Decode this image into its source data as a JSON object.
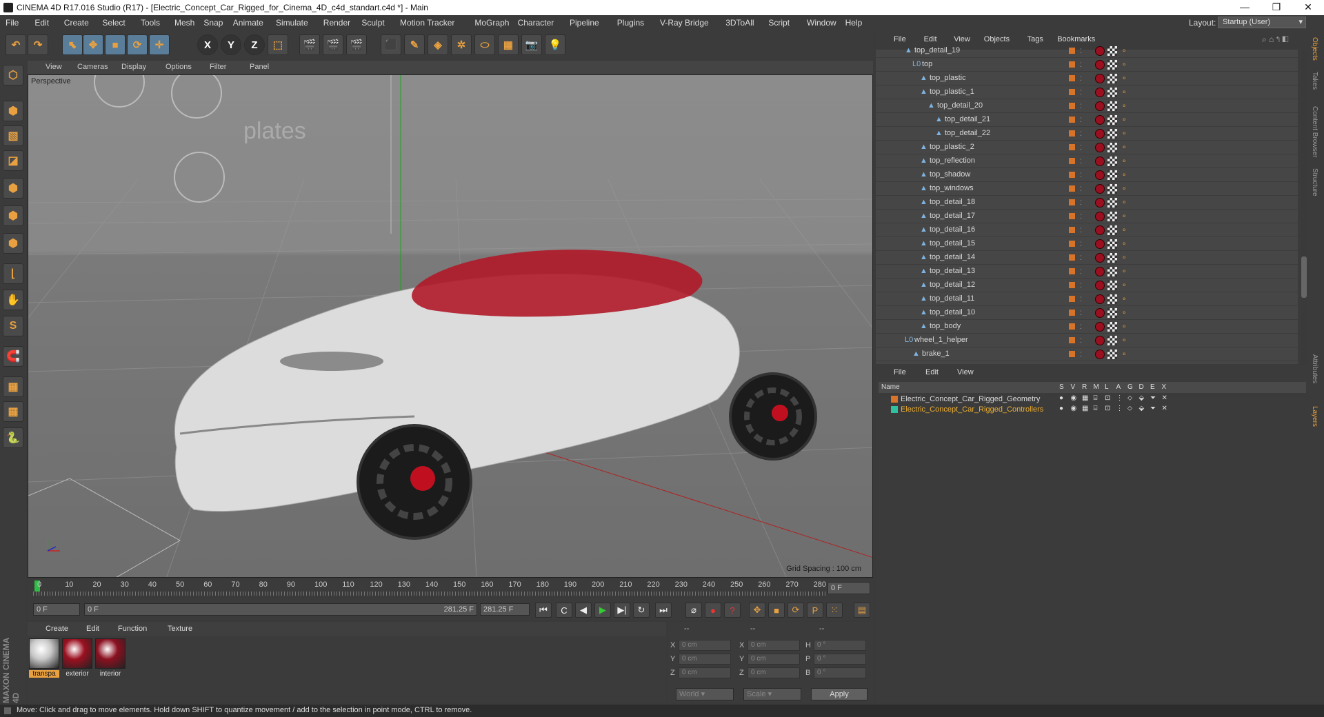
{
  "window": {
    "title": "CINEMA 4D R17.016 Studio (R17) - [Electric_Concept_Car_Rigged_for_Cinema_4D_c4d_standart.c4d *] - Main",
    "controls": [
      "—",
      "❐",
      "✕"
    ]
  },
  "menubar": {
    "items": [
      "File",
      "Edit",
      "Create",
      "Select",
      "Tools",
      "Mesh",
      "Snap",
      "Animate",
      "Simulate",
      "Render",
      "Sculpt",
      "Motion Tracker",
      "MoGraph",
      "Character",
      "Pipeline",
      "Plugins",
      "V-Ray Bridge",
      "3DToAll",
      "Script",
      "Window",
      "Help"
    ],
    "layout_label": "Layout:",
    "layout_value": "Startup (User)"
  },
  "toolbar": {
    "icons": [
      "undo-icon",
      "redo-icon",
      "live-select-icon",
      "move-icon",
      "scale-icon",
      "rotate-icon",
      "transform-icon",
      "x-axis-icon",
      "y-axis-icon",
      "z-axis-icon",
      "coordinate-system-icon",
      "render-view-icon",
      "render-picture-viewer-icon",
      "edit-render-settings-icon",
      "cube-icon",
      "pen-icon",
      "subdivision-icon",
      "cloner-icon",
      "deformer-icon",
      "floor-icon",
      "camera-icon",
      "light-icon"
    ],
    "axis_labels": [
      "X",
      "Y",
      "Z"
    ]
  },
  "viewport": {
    "menu": [
      "View",
      "Cameras",
      "Display",
      "Options",
      "Filter",
      "Panel"
    ],
    "label": "Perspective",
    "grid_spacing": "Grid Spacing : 100 cm",
    "watermark": "plates"
  },
  "timeline": {
    "ticks": [
      "0",
      "10",
      "20",
      "30",
      "40",
      "50",
      "60",
      "70",
      "80",
      "90",
      "100",
      "110",
      "120",
      "130",
      "140",
      "150",
      "160",
      "170",
      "180",
      "190",
      "200",
      "210",
      "220",
      "230",
      "240",
      "250",
      "260",
      "270",
      "280"
    ],
    "current_frame": "0 F"
  },
  "playback": {
    "start": "0 F",
    "min": "0 F",
    "max": "281.25 F",
    "end": "281.25 F"
  },
  "materials": {
    "menu": [
      "Create",
      "Edit",
      "Function",
      "Texture"
    ],
    "items": [
      {
        "label": "transpa",
        "color": "#c8c8c8"
      },
      {
        "label": "exterior",
        "color": "#9b1020"
      },
      {
        "label": "interior",
        "color": "#8a1020"
      }
    ]
  },
  "coordinates": {
    "header": [
      "--",
      "--",
      "--"
    ],
    "rows": [
      {
        "a": "X",
        "av": "0 cm",
        "b": "X",
        "bv": "0 cm",
        "c": "H",
        "cv": "0 °"
      },
      {
        "a": "Y",
        "av": "0 cm",
        "b": "Y",
        "bv": "0 cm",
        "c": "P",
        "cv": "0 °"
      },
      {
        "a": "Z",
        "av": "0 cm",
        "b": "Z",
        "bv": "0 cm",
        "c": "B",
        "cv": "0 °"
      }
    ],
    "world": "World",
    "scale": "Scale",
    "apply": "Apply"
  },
  "object_manager": {
    "menu": [
      "File",
      "Edit",
      "View",
      "Objects",
      "Tags",
      "Bookmarks"
    ],
    "rows": [
      {
        "name": "top_detail_19",
        "indent": 2,
        "type": "poly"
      },
      {
        "name": "top",
        "indent": 3,
        "type": "null"
      },
      {
        "name": "top_plastic",
        "indent": 4,
        "type": "poly"
      },
      {
        "name": "top_plastic_1",
        "indent": 4,
        "type": "poly"
      },
      {
        "name": "top_detail_20",
        "indent": 5,
        "type": "poly"
      },
      {
        "name": "top_detail_21",
        "indent": 6,
        "type": "poly"
      },
      {
        "name": "top_detail_22",
        "indent": 6,
        "type": "poly"
      },
      {
        "name": "top_plastic_2",
        "indent": 4,
        "type": "poly"
      },
      {
        "name": "top_reflection",
        "indent": 4,
        "type": "poly"
      },
      {
        "name": "top_shadow",
        "indent": 4,
        "type": "poly"
      },
      {
        "name": "top_windows",
        "indent": 4,
        "type": "poly"
      },
      {
        "name": "top_detail_18",
        "indent": 4,
        "type": "poly"
      },
      {
        "name": "top_detail_17",
        "indent": 4,
        "type": "poly"
      },
      {
        "name": "top_detail_16",
        "indent": 4,
        "type": "poly"
      },
      {
        "name": "top_detail_15",
        "indent": 4,
        "type": "poly"
      },
      {
        "name": "top_detail_14",
        "indent": 4,
        "type": "poly"
      },
      {
        "name": "top_detail_13",
        "indent": 4,
        "type": "poly"
      },
      {
        "name": "top_detail_12",
        "indent": 4,
        "type": "poly"
      },
      {
        "name": "top_detail_11",
        "indent": 4,
        "type": "poly"
      },
      {
        "name": "top_detail_10",
        "indent": 4,
        "type": "poly"
      },
      {
        "name": "top_body",
        "indent": 4,
        "type": "poly"
      },
      {
        "name": "wheel_1_helper",
        "indent": 2,
        "type": "null"
      },
      {
        "name": "brake_1",
        "indent": 3,
        "type": "poly"
      }
    ]
  },
  "layer_manager": {
    "menu": [
      "File",
      "Edit",
      "View"
    ],
    "columns": [
      "Name",
      "S",
      "V",
      "R",
      "M",
      "L",
      "A",
      "G",
      "D",
      "E",
      "X"
    ],
    "layers": [
      {
        "name": "Electric_Concept_Car_Rigged_Geometry",
        "color": "#d8742a",
        "text_color": "#d8d8d8"
      },
      {
        "name": "Electric_Concept_Car_Rigged_Controllers",
        "color": "#30c0a0",
        "text_color": "#f0b030"
      }
    ]
  },
  "right_tabs": [
    "Objects",
    "Takes",
    "Content Browser",
    "Structure",
    "Attributes",
    "Layers"
  ],
  "status": "Move: Click and drag to move elements. Hold down SHIFT to quantize movement / add to the selection in point mode, CTRL to remove.",
  "brand": "MAXON CINEMA 4D"
}
